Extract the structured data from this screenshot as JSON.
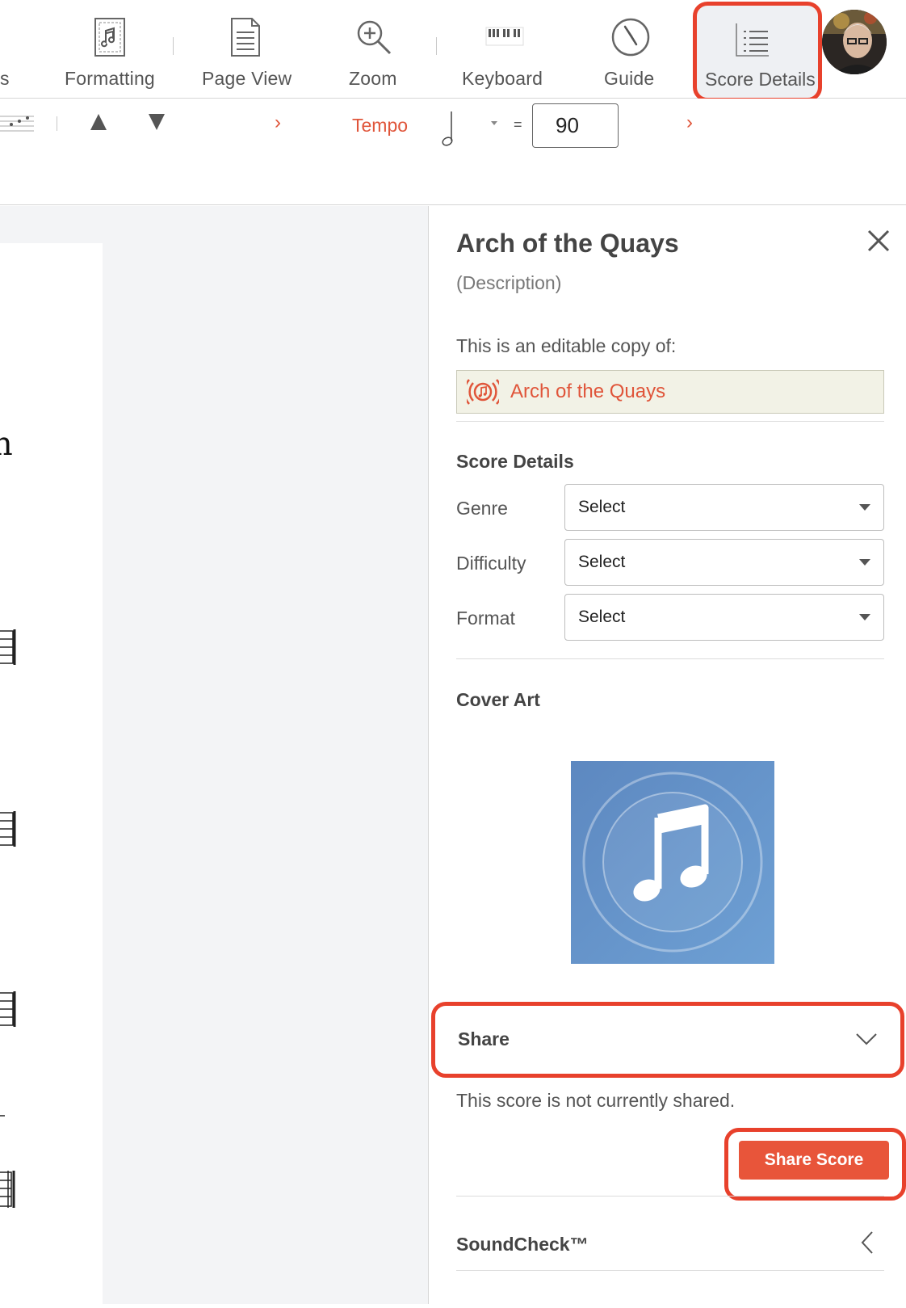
{
  "toolbar": {
    "items": [
      {
        "label": "s",
        "icon": "pen-icon"
      },
      {
        "label": "Formatting",
        "icon": "music-page-icon"
      },
      {
        "label": "Page View",
        "icon": "document-icon"
      },
      {
        "label": "Zoom",
        "icon": "zoom-in-icon"
      },
      {
        "label": "Keyboard",
        "icon": "piano-keys-icon"
      },
      {
        "label": "Guide",
        "icon": "compass-icon"
      },
      {
        "label": "Score Details",
        "icon": "list-icon"
      }
    ],
    "user_avatar": "avatar"
  },
  "subbar": {
    "tempo_label": "Tempo",
    "equals": "=",
    "tempo_value": "90",
    "up_icon": "triangle-up-icon",
    "down_icon": "triangle-down-icon"
  },
  "panel": {
    "title": "Arch of the Quays",
    "description": "(Description)",
    "copy_text": "This is an editable copy of:",
    "source_title": "Arch of the Quays",
    "score_details": {
      "heading": "Score Details",
      "fields": [
        {
          "label": "Genre",
          "value": "Select"
        },
        {
          "label": "Difficulty",
          "value": "Select"
        },
        {
          "label": "Format",
          "value": "Select"
        }
      ]
    },
    "cover_art": {
      "heading": "Cover Art",
      "icon": "music-note-icon"
    },
    "share": {
      "heading": "Share",
      "message": "This score is not currently shared.",
      "button": "Share Score"
    },
    "soundcheck": {
      "heading": "SoundCheck™"
    }
  },
  "colors": {
    "accent": "#e8553a",
    "highlight": "#e8412c",
    "source_bg": "#f2f2e6",
    "cover_bg": "#6a98cc"
  }
}
